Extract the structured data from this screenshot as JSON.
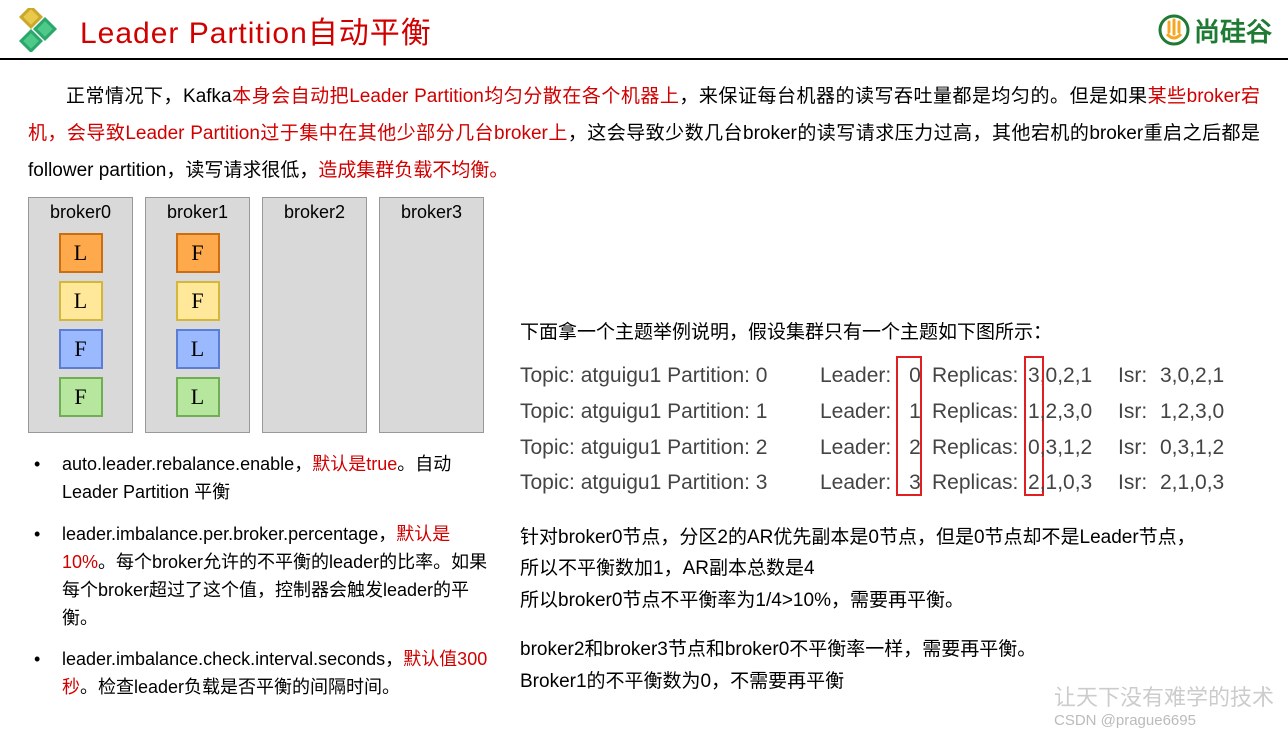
{
  "header": {
    "title": "Leader Partition自动平衡",
    "brand": "尚硅谷"
  },
  "paragraph": {
    "p1a": "正常情况下，Kafka",
    "p1b": "本身会自动把Leader  Partition均匀分散在各个机器上",
    "p1c": "，来保证每台机器的读写吞吐量都是均匀的。但是如果",
    "p1d": "某些broker宕机，会导致Leader  Partition过于集中在其他少部分几台broker上",
    "p1e": "，这会导致少数几台broker的读写请求压力过高，其他宕机的broker重启之后都是follower partition，读写请求很低，",
    "p1f": "造成集群负载不均衡。"
  },
  "brokers": [
    {
      "name": "broker0",
      "slots": [
        {
          "txt": "L",
          "cls": "c-orange"
        },
        {
          "txt": "L",
          "cls": "c-yellow"
        },
        {
          "txt": "F",
          "cls": "c-blue"
        },
        {
          "txt": "F",
          "cls": "c-green"
        }
      ]
    },
    {
      "name": "broker1",
      "slots": [
        {
          "txt": "F",
          "cls": "c-orange"
        },
        {
          "txt": "F",
          "cls": "c-yellow"
        },
        {
          "txt": "L",
          "cls": "c-blue"
        },
        {
          "txt": "L",
          "cls": "c-green"
        }
      ]
    },
    {
      "name": "broker2",
      "slots": []
    },
    {
      "name": "broker3",
      "slots": []
    }
  ],
  "bullets": [
    {
      "t1": "auto.leader.rebalance.enable，",
      "thl": "默认是true",
      "t2": "。自动Leader Partition 平衡"
    },
    {
      "t1": "leader.imbalance.per.broker.percentage，",
      "thl": "默认是10%",
      "t2": "。每个broker允许的不平衡的leader的比率。如果每个broker超过了这个值，控制器会触发leader的平衡。"
    },
    {
      "t1": "leader.imbalance.check.interval.seconds，",
      "thl": "默认值300秒",
      "t2": "。检查leader负载是否平衡的间隔时间。"
    }
  ],
  "example": {
    "lead": "下面拿一个主题举例说明，假设集群只有一个主题如下图所示：",
    "rows": [
      {
        "topic": "Topic: atguigu1 Partition: 0",
        "leader": "0",
        "replicas": "3,0,2,1",
        "isr": "3,0,2,1"
      },
      {
        "topic": "Topic: atguigu1 Partition: 1",
        "leader": "1",
        "replicas": "1,2,3,0",
        "isr": "1,2,3,0"
      },
      {
        "topic": "Topic: atguigu1 Partition: 2",
        "leader": "2",
        "replicas": "0,3,1,2",
        "isr": "0,3,1,2"
      },
      {
        "topic": "Topic: atguigu1 Partition: 3",
        "leader": "3",
        "replicas": "2,1,0,3",
        "isr": "2,1,0,3"
      }
    ],
    "labels": {
      "leader": "Leader: ",
      "replicas": "Replicas: ",
      "isr": "Isr: "
    },
    "ex1": "针对broker0节点，分区2的AR优先副本是0节点，但是0节点却不是Leader节点，",
    "ex2": "所以不平衡数加1，AR副本总数是4",
    "ex3": "所以broker0节点不平衡率为1/4>10%，需要再平衡。",
    "ex4": "broker2和broker3节点和broker0不平衡率一样，需要再平衡。",
    "ex5": "Broker1的不平衡数为0，不需要再平衡"
  },
  "watermark": {
    "line1": "让天下没有难学的技术",
    "line2": "CSDN @prague6695"
  }
}
